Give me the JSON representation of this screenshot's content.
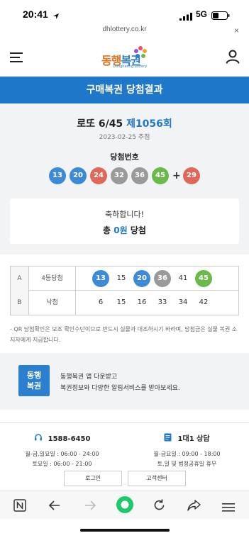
{
  "status_bar": {
    "time": "20:41",
    "network": "5G"
  },
  "browser": {
    "url": "dhlottery.co.kr",
    "close": "×"
  },
  "header": {
    "logo_main": "동행",
    "logo_blue": "복권",
    "logo_sub": "Donghaeng Lottery"
  },
  "banner": {
    "title": "구매복권 당첨결과"
  },
  "game": {
    "name": "로또 6/45",
    "round": "제1056회",
    "date": "2023-02-25 추첨",
    "win_label": "당첨번호",
    "numbers": [
      "13",
      "20",
      "24",
      "32",
      "36",
      "45"
    ],
    "plus": "+",
    "bonus": "29",
    "colors": {
      "blue": "#3d8ad6",
      "red": "#e0685a",
      "gray": "#9a9a9a",
      "green": "#6ab94a"
    }
  },
  "result_card": {
    "line1": "축하합니다!",
    "prefix": "총",
    "amount": "0원",
    "suffix": "당첨"
  },
  "table": {
    "rows": [
      {
        "id": "A",
        "rank": "4등당첨",
        "numbers": [
          "13",
          "15",
          "20",
          "36",
          "41",
          "45"
        ]
      },
      {
        "id": "B",
        "rank": "낙첨",
        "numbers": [
          "6",
          "15",
          "16",
          "33",
          "34",
          "42"
        ]
      }
    ]
  },
  "note": "- QR 당첨확인은 보조 확인수단이므로 반드시 실물과 대조하시기 바라며, 당첨금은 실물 복권 소지자에게 지급합니다.",
  "promo": {
    "icon_line1": "동행",
    "icon_line2": "복권",
    "line1": "동행복권 앱 다운받고",
    "line2": "복권정보와 다양한 알림서비스를 받아보세요."
  },
  "footer": {
    "phone": "1588-6450",
    "phone_hours1": "월-금,일요일 : 06:00 - 24:00",
    "phone_hours2": "토요일 : 06:00 - 21:00",
    "chat": "1대1 상담",
    "chat_hours1": "월-금요일 : 09:00 - 18:00",
    "chat_hours2": "토,일 및 법정공휴일 휴무",
    "login": "로그인",
    "support": "고객센터"
  }
}
